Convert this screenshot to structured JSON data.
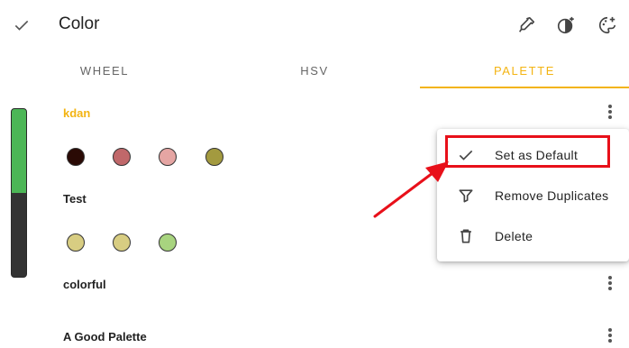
{
  "header": {
    "title": "Color",
    "confirm_icon": "check-icon",
    "actions": [
      "eyedropper-icon",
      "contrast-icon",
      "palette-add-icon"
    ]
  },
  "tabs": [
    {
      "label": "WHEEL",
      "active": false
    },
    {
      "label": "HSV",
      "active": false
    },
    {
      "label": "PALETTE",
      "active": true
    }
  ],
  "accent_color": "#f3b413",
  "slider": {
    "fill_fraction": 0.5,
    "fill_color": "#4cb656"
  },
  "palettes": [
    {
      "name": "kdan",
      "selected": true,
      "colors": [
        "#2a0a05",
        "#c0686a",
        "#e5a5a3",
        "#a39a3f"
      ]
    },
    {
      "name": "Test",
      "selected": false,
      "colors": [
        "#d8cd82",
        "#d8cd82",
        "#a8d47f"
      ]
    },
    {
      "name": "colorful",
      "selected": false,
      "colors": []
    },
    {
      "name": "A Good Palette",
      "selected": false,
      "colors": []
    }
  ],
  "menu": {
    "items": [
      {
        "label": "Set as Default",
        "icon": "check-icon"
      },
      {
        "label": "Remove Duplicates",
        "icon": "filter-icon"
      },
      {
        "label": "Delete",
        "icon": "trash-icon"
      }
    ]
  },
  "annotation": {
    "highlight_color": "#e8101a"
  }
}
